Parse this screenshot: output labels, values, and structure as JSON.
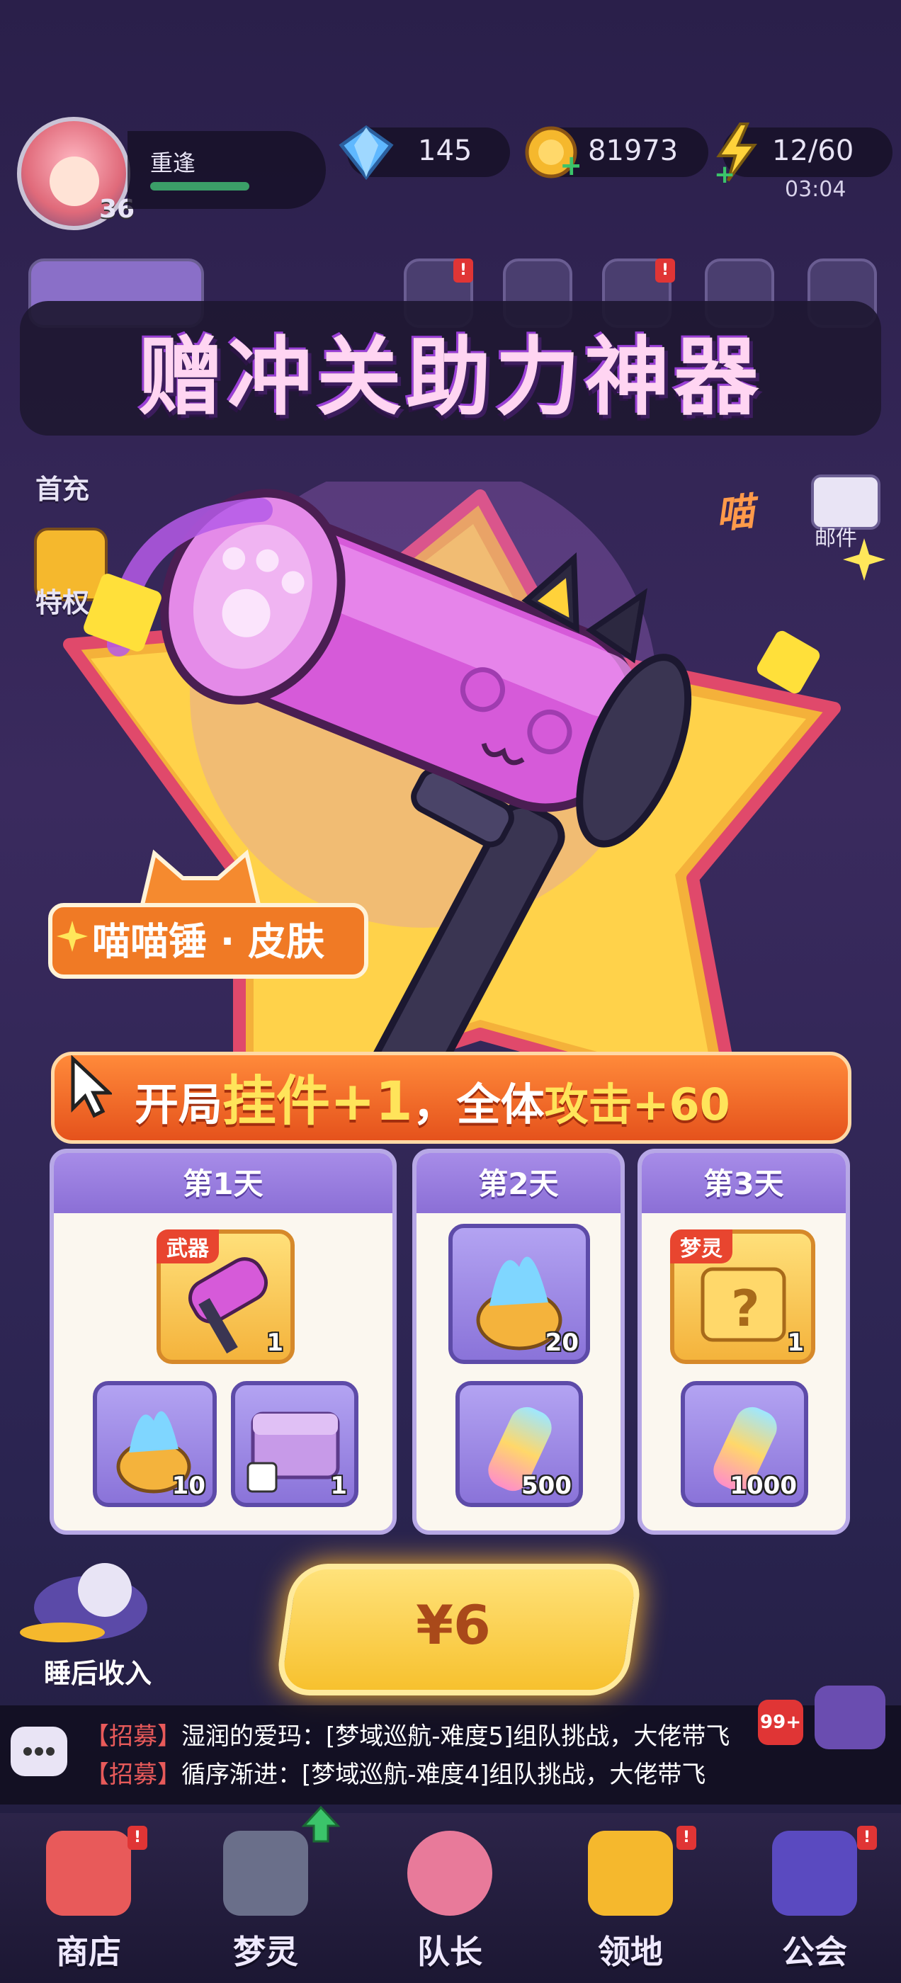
{
  "header": {
    "player_name": "重逢",
    "level": "36",
    "gems": "145",
    "coins": "81973",
    "energy": "12/60",
    "energy_timer": "03:04"
  },
  "side_menu": {
    "left": [
      "首充",
      "特权"
    ],
    "right": [
      "邮件"
    ]
  },
  "banner": {
    "title": "赠冲关助力神器"
  },
  "skin": {
    "name": "喵喵锤 · 皮肤",
    "mark": "喵"
  },
  "ribbon": {
    "prefix": "开局",
    "highlight": "挂件+1",
    "suffix": "，全体",
    "highlight2": "攻击+60"
  },
  "days": [
    {
      "title": "第1天",
      "items": [
        {
          "name": "hammer-weapon",
          "tag": "武器",
          "qty": "1"
        },
        {
          "name": "blue-flame-pot",
          "qty": "10"
        },
        {
          "name": "purple-chest",
          "qty": "1"
        }
      ]
    },
    {
      "title": "第2天",
      "items": [
        {
          "name": "blue-flame-pot",
          "qty": "20"
        },
        {
          "name": "rainbow-bottle",
          "qty": "500"
        }
      ]
    },
    {
      "title": "第3天",
      "items": [
        {
          "name": "mystery-box",
          "tag": "梦灵",
          "qty": "1"
        },
        {
          "name": "rainbow-bottle",
          "qty": "1000"
        }
      ]
    }
  ],
  "pay": {
    "price": "¥6"
  },
  "sleep_income": "睡后收入",
  "chat": {
    "badge": "99+",
    "lines": [
      {
        "tag": "【招募】",
        "text": "湿润的爱玛：[梦域巡航-难度5]组队挑战，大佬带飞"
      },
      {
        "tag": "【招募】",
        "text": "循序渐进：[梦域巡航-难度4]组队挑战，大佬带飞"
      }
    ]
  },
  "nav": [
    "商店",
    "梦灵",
    "队长",
    "领地",
    "公会"
  ],
  "colors": {
    "accent_orange": "#f07a25",
    "gold": "#f7c12e",
    "purple": "#8b6fd6"
  }
}
